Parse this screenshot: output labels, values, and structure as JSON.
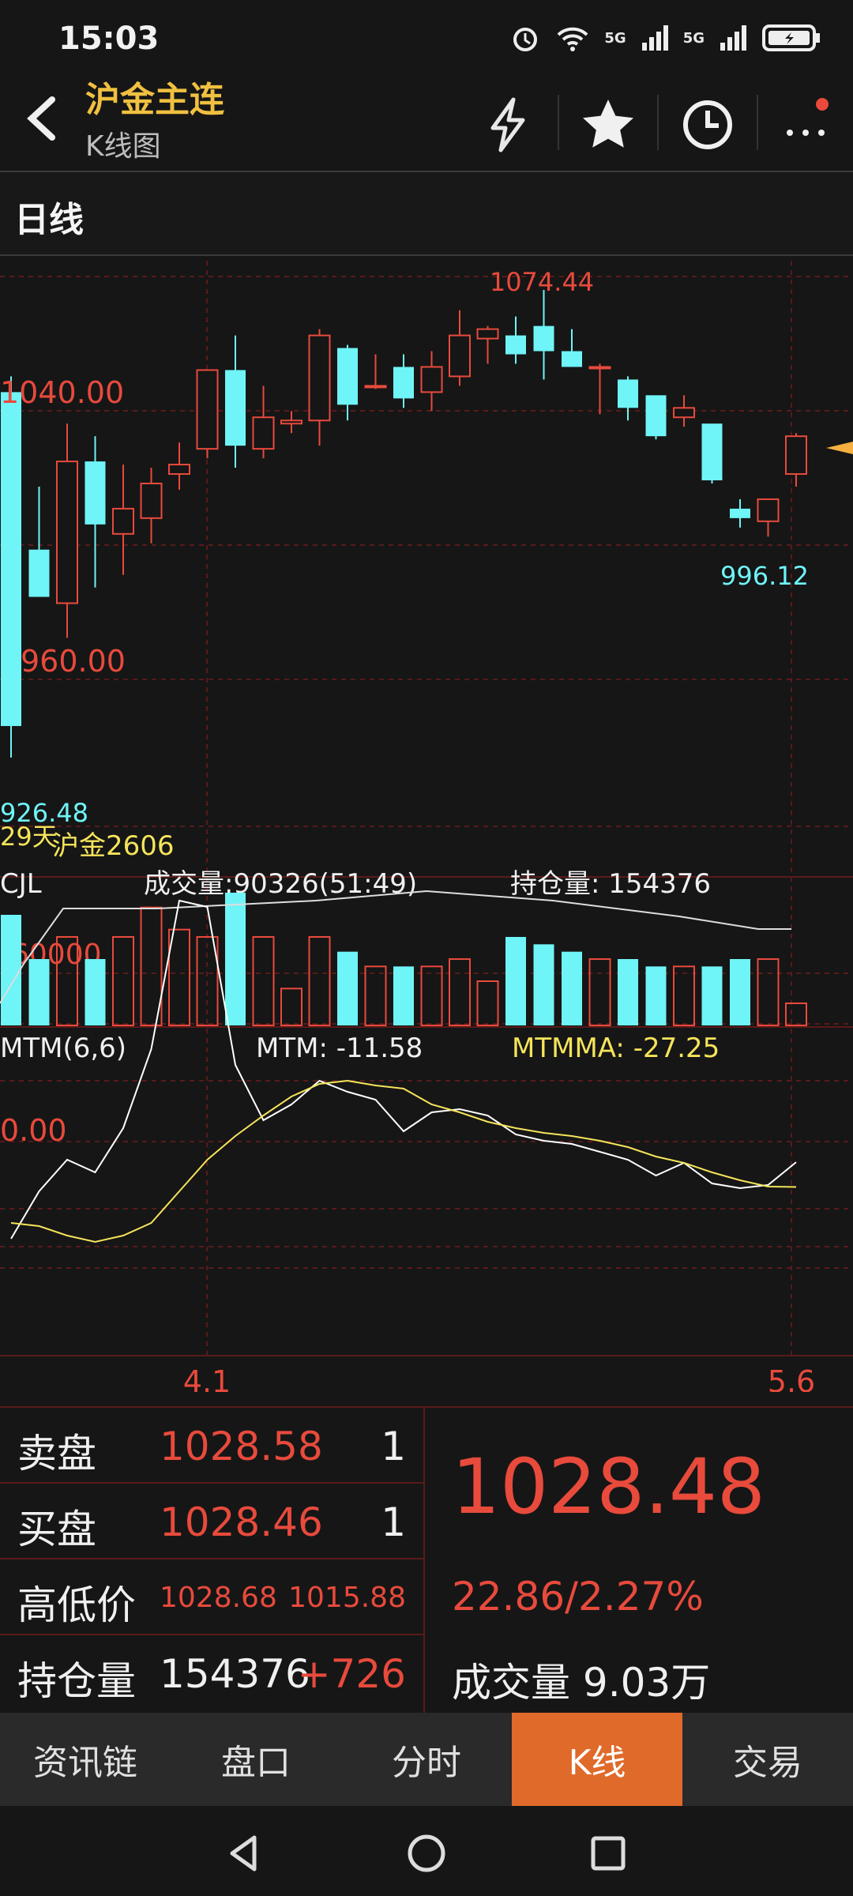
{
  "status_bar": {
    "time": "15:03",
    "signal_1": "5G",
    "signal_2": "5G"
  },
  "header": {
    "title": "沪金主连",
    "subtitle": "K线图"
  },
  "toolbar": {
    "icons": [
      "lightning-icon",
      "star-icon",
      "clock-icon",
      "more-icon"
    ],
    "notification_dot_color": "#e84a3c"
  },
  "period": {
    "label": "日线"
  },
  "chart": {
    "type": "candlestick",
    "price_labels": {
      "high": "1074.44",
      "low": "996.12",
      "left_low": "926.48",
      "axis_top": "1040.00",
      "axis_mid": "960.00"
    },
    "bottom_left_label": "29天",
    "contract_label": "沪金2606",
    "volume": {
      "title": "CJL",
      "value_text": "成交量:90326(51:49)",
      "open_interest_text": "持仓量: 154376",
      "axis_label": "60000"
    },
    "mtm": {
      "title": "MTM(6,6)",
      "mtm_text": "MTM: -11.58",
      "mtmma_text": "MTMMA: -27.25",
      "axis_label": "0.00"
    },
    "x_labels": [
      "4.1",
      "5.6"
    ],
    "colors": {
      "up": "#e84a3c",
      "down": "#6ff4f7",
      "grid": "#5a1a1a",
      "mtm": "#ffffff",
      "mtmma": "#f5e45a"
    }
  },
  "chart_data": {
    "type": "candlestick",
    "candles": [
      {
        "o": 1042,
        "h": 1047,
        "l": 926,
        "c": 936
      },
      {
        "o": 992,
        "h": 1012,
        "l": 978,
        "c": 977
      },
      {
        "o": 975,
        "h": 1032,
        "l": 964,
        "c": 1020
      },
      {
        "o": 1020,
        "h": 1028,
        "l": 980,
        "c": 1000
      },
      {
        "o": 997,
        "h": 1019,
        "l": 984,
        "c": 1005
      },
      {
        "o": 1002,
        "h": 1018,
        "l": 994,
        "c": 1013
      },
      {
        "o": 1016,
        "h": 1026,
        "l": 1011,
        "c": 1019
      },
      {
        "o": 1024,
        "h": 1044,
        "l": 1021,
        "c": 1049
      },
      {
        "o": 1049,
        "h": 1060,
        "l": 1018,
        "c": 1025
      },
      {
        "o": 1024,
        "h": 1044,
        "l": 1021,
        "c": 1034
      },
      {
        "o": 1032,
        "h": 1036,
        "l": 1029,
        "c": 1033
      },
      {
        "o": 1033,
        "h": 1062,
        "l": 1025,
        "c": 1060
      },
      {
        "o": 1056,
        "h": 1057,
        "l": 1033,
        "c": 1038
      },
      {
        "o": 1044,
        "h": 1054,
        "l": 1043,
        "c": 1044
      },
      {
        "o": 1050,
        "h": 1054,
        "l": 1037,
        "c": 1040
      },
      {
        "o": 1042,
        "h": 1055,
        "l": 1036,
        "c": 1050
      },
      {
        "o": 1047,
        "h": 1068,
        "l": 1044,
        "c": 1060
      },
      {
        "o": 1059,
        "h": 1063,
        "l": 1051,
        "c": 1062
      },
      {
        "o": 1060,
        "h": 1066,
        "l": 1051,
        "c": 1054
      },
      {
        "o": 1063,
        "h": 1074.44,
        "l": 1046,
        "c": 1055
      },
      {
        "o": 1055,
        "h": 1062,
        "l": 1050,
        "c": 1050
      },
      {
        "o": 1050,
        "h": 1051,
        "l": 1035,
        "c": 1050
      },
      {
        "o": 1046,
        "h": 1047,
        "l": 1033,
        "c": 1037
      },
      {
        "o": 1041,
        "h": 1041,
        "l": 1027,
        "c": 1028
      },
      {
        "o": 1034,
        "h": 1041,
        "l": 1031,
        "c": 1037
      },
      {
        "o": 1032,
        "h": 1032,
        "l": 1013,
        "c": 1014
      },
      {
        "o": 1005,
        "h": 1008,
        "l": 999,
        "c": 1002
      },
      {
        "o": 1001,
        "h": 1006,
        "l": 996.12,
        "c": 1008
      },
      {
        "o": 1016,
        "h": 1029,
        "l": 1012,
        "c": 1028
      }
    ],
    "volume": [
      15,
      9,
      12,
      9,
      12,
      16,
      13,
      12,
      18,
      12,
      5,
      12,
      10,
      8,
      8,
      8,
      9,
      6,
      12,
      11,
      10,
      9,
      9,
      8,
      8,
      8,
      9,
      9,
      3
    ],
    "mtm": [
      -60,
      -30,
      -10,
      -18,
      10,
      60,
      154,
      150,
      50,
      15,
      25,
      40,
      33,
      28,
      8,
      20,
      22,
      18,
      6,
      2,
      0,
      -5,
      -10,
      -20,
      -12,
      -25,
      -28,
      -26,
      -11.58
    ],
    "mtmma": [
      -50,
      -52,
      -58,
      -62,
      -58,
      -50,
      -30,
      -10,
      5,
      18,
      30,
      38,
      40,
      37,
      35,
      25,
      20,
      14,
      10,
      7,
      5,
      2,
      -2,
      -8,
      -12,
      -18,
      -23,
      -27,
      -27.25
    ],
    "ylim": [
      926.48,
      1074.44
    ]
  },
  "quote": {
    "sell_label": "卖盘",
    "sell_price": "1028.58",
    "sell_qty": "1",
    "buy_label": "买盘",
    "buy_price": "1028.46",
    "buy_qty": "1",
    "hl_label": "高低价",
    "high": "1028.68",
    "low": "1015.88",
    "oi_label": "持仓量",
    "oi": "154376",
    "oi_change": "+726",
    "last_price": "1028.48",
    "change": "22.86/2.27%",
    "volume_label": "成交量",
    "volume_value": "9.03万"
  },
  "tabs": [
    {
      "label": "资讯链",
      "active": false
    },
    {
      "label": "盘口",
      "active": false
    },
    {
      "label": "分时",
      "active": false
    },
    {
      "label": "K线",
      "active": true
    },
    {
      "label": "交易",
      "active": false
    }
  ]
}
